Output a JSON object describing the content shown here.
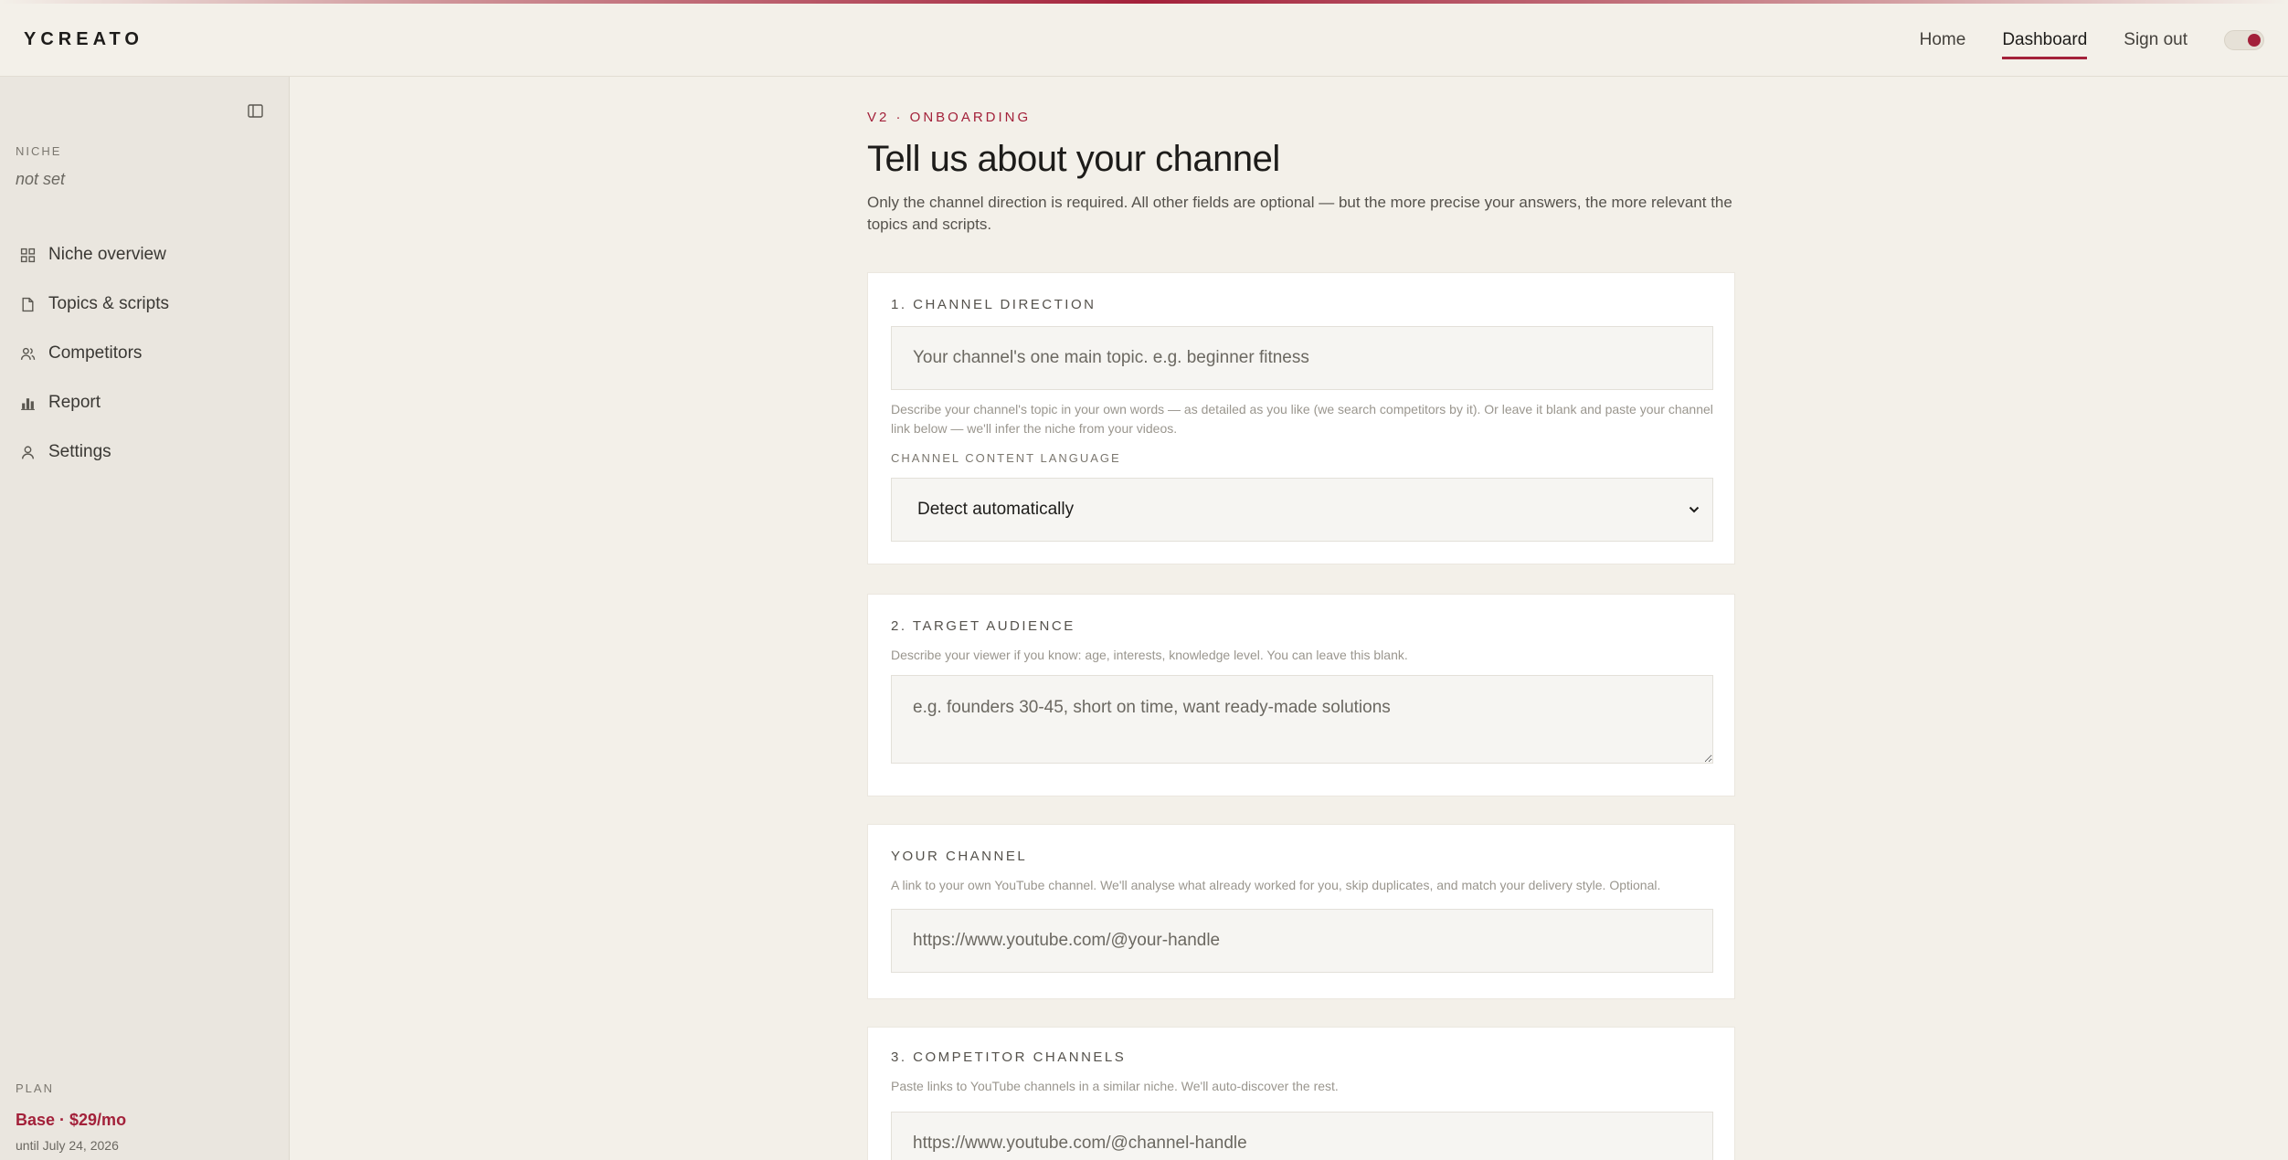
{
  "app": {
    "brand": "YCREATO"
  },
  "topnav": {
    "home": "Home",
    "dashboard": "Dashboard",
    "signout": "Sign out",
    "accent_color": "#a3213a"
  },
  "sidebar": {
    "niche_label": "NICHE",
    "niche_value": "not set",
    "items": [
      {
        "label": "Niche overview",
        "icon": "grid-icon"
      },
      {
        "label": "Topics & scripts",
        "icon": "document-icon"
      },
      {
        "label": "Competitors",
        "icon": "users-icon"
      },
      {
        "label": "Report",
        "icon": "bar-chart-icon"
      },
      {
        "label": "Settings",
        "icon": "user-icon"
      }
    ],
    "plan_label": "PLAN",
    "plan_value": "Base · $29/mo",
    "plan_until": "until July 24, 2026"
  },
  "main": {
    "eyebrow": "V2 · ONBOARDING",
    "title": "Tell us about your channel",
    "intro": "Only the channel direction is required. All other fields are optional — but the more precise your answers, the more relevant the topics and scripts.",
    "sections": {
      "direction": {
        "title": "1. CHANNEL DIRECTION",
        "placeholder": "Your channel's one main topic. e.g. beginner fitness",
        "help": "Describe your channel's topic in your own words — as detailed as you like (we search competitors by it). Or leave it blank and paste your channel link below — we'll infer the niche from your videos.",
        "language_label": "CHANNEL CONTENT LANGUAGE",
        "language_value": "Detect automatically"
      },
      "audience": {
        "title": "2. TARGET AUDIENCE",
        "help": "Describe your viewer if you know: age, interests, knowledge level. You can leave this blank.",
        "placeholder": "e.g. founders 30-45, short on time, want ready-made solutions"
      },
      "your_channel": {
        "title": "YOUR CHANNEL",
        "help": "A link to your own YouTube channel. We'll analyse what already worked for you, skip duplicates, and match your delivery style. Optional.",
        "placeholder": "https://www.youtube.com/@your-handle"
      },
      "competitors": {
        "title": "3. COMPETITOR CHANNELS",
        "help": "Paste links to YouTube channels in a similar niche. We'll auto-discover the rest.",
        "placeholder": "https://www.youtube.com/@channel-handle"
      }
    }
  }
}
